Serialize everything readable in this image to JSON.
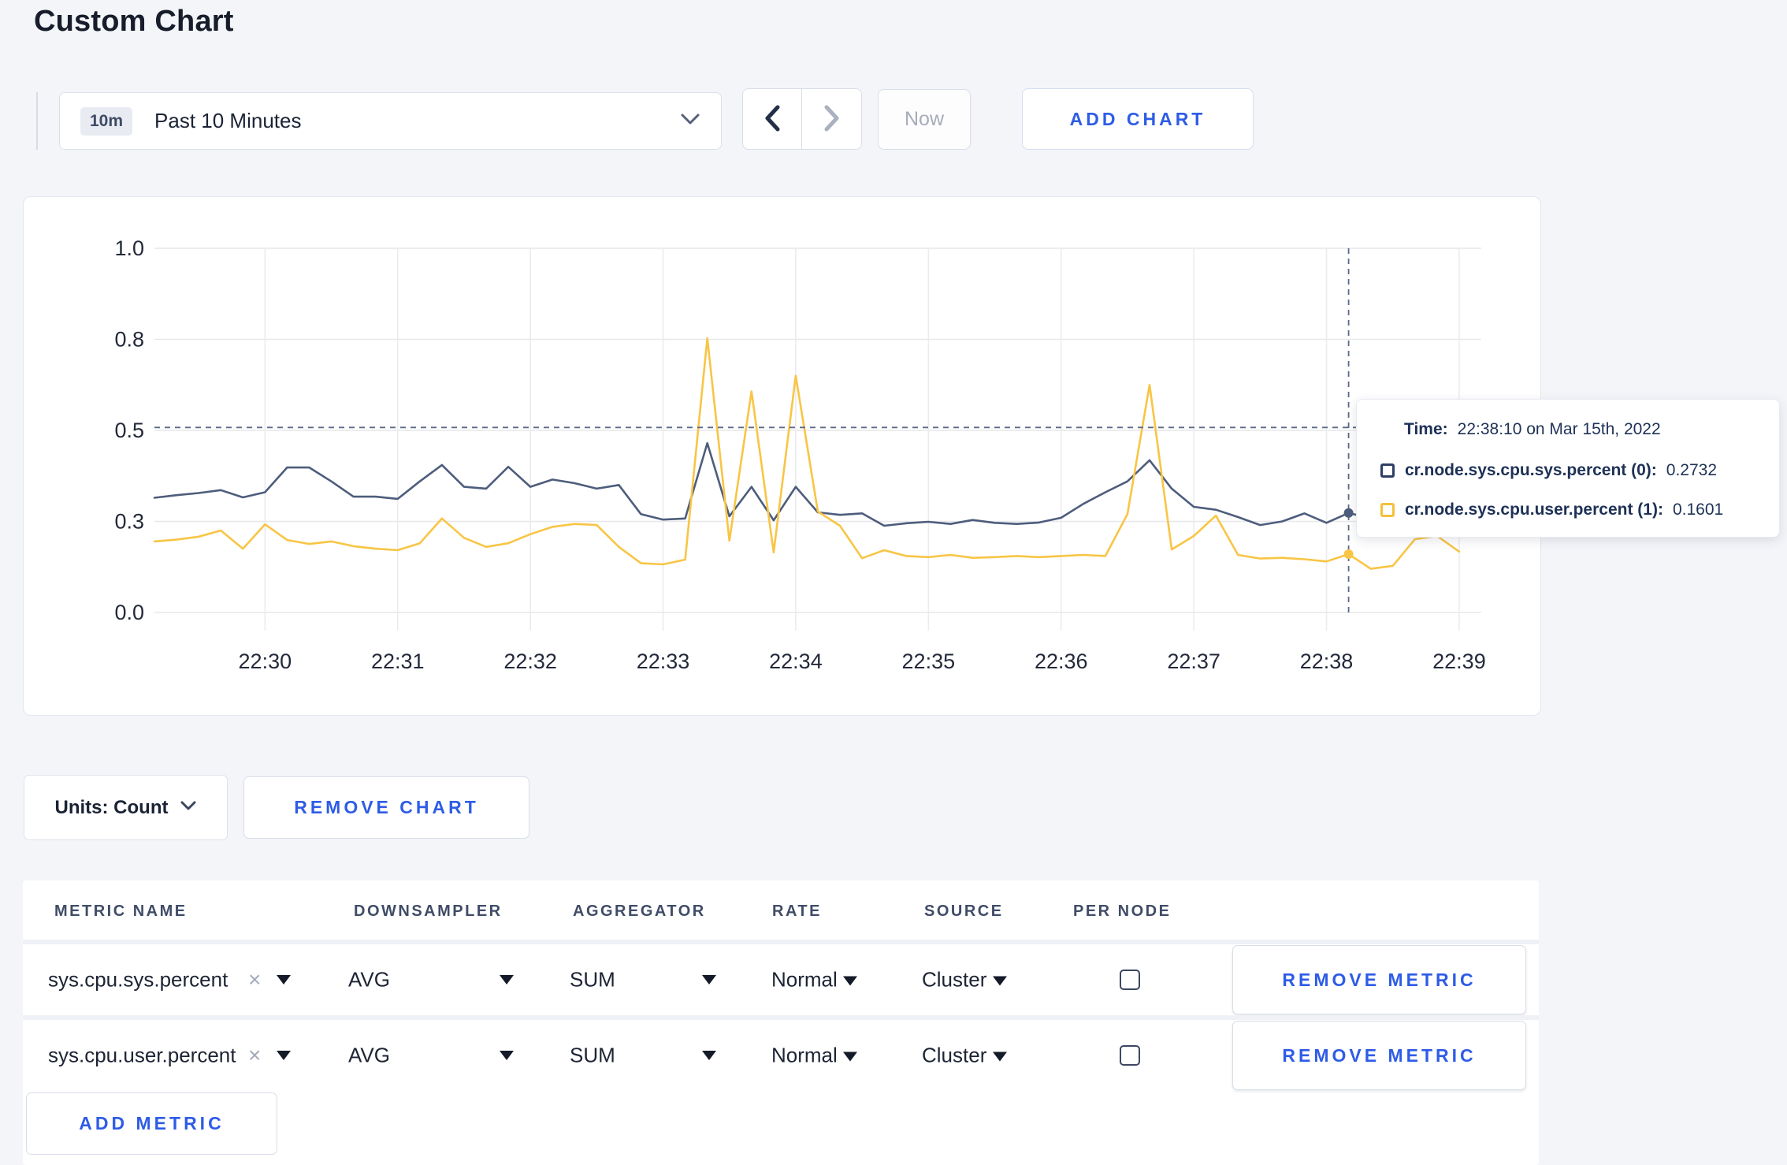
{
  "page": {
    "title": "Custom Chart"
  },
  "toolbar": {
    "range_badge": "10m",
    "range_label": "Past 10 Minutes",
    "now_label": "Now",
    "add_chart_label": "ADD CHART"
  },
  "chart_data": {
    "type": "line",
    "x_start": "22:29:10",
    "x_step_seconds": 10,
    "x_ticks": [
      "22:30",
      "22:31",
      "22:32",
      "22:33",
      "22:34",
      "22:35",
      "22:36",
      "22:37",
      "22:38",
      "22:39"
    ],
    "y_ticks": [
      {
        "label": "0.0",
        "v": 0.0
      },
      {
        "label": "0.3",
        "v": 0.25
      },
      {
        "label": "0.5",
        "v": 0.5
      },
      {
        "label": "0.8",
        "v": 0.75
      },
      {
        "label": "1.0",
        "v": 1.0
      }
    ],
    "ylim": [
      0,
      1
    ],
    "grid": true,
    "crosshair": {
      "index": 54,
      "time": "22:38:10",
      "hline_value": 0.508
    },
    "series": [
      {
        "name": "cr.node.sys.cpu.sys.percent",
        "color": "#4d5d7c",
        "values": [
          0.315,
          0.322,
          0.328,
          0.336,
          0.316,
          0.33,
          0.398,
          0.398,
          0.36,
          0.318,
          0.318,
          0.312,
          0.36,
          0.405,
          0.345,
          0.34,
          0.4,
          0.345,
          0.365,
          0.355,
          0.34,
          0.35,
          0.27,
          0.255,
          0.258,
          0.465,
          0.264,
          0.345,
          0.253,
          0.345,
          0.275,
          0.268,
          0.272,
          0.238,
          0.245,
          0.249,
          0.243,
          0.254,
          0.246,
          0.243,
          0.247,
          0.26,
          0.298,
          0.33,
          0.36,
          0.418,
          0.34,
          0.29,
          0.282,
          0.262,
          0.24,
          0.25,
          0.272,
          0.246,
          0.2732,
          0.258,
          0.262,
          0.258,
          0.262,
          0.268
        ]
      },
      {
        "name": "cr.node.sys.cpu.user.percent",
        "color": "#f8c545",
        "values": [
          0.195,
          0.2,
          0.208,
          0.225,
          0.175,
          0.242,
          0.199,
          0.188,
          0.195,
          0.182,
          0.175,
          0.171,
          0.19,
          0.258,
          0.205,
          0.18,
          0.19,
          0.215,
          0.235,
          0.243,
          0.24,
          0.18,
          0.135,
          0.132,
          0.145,
          0.753,
          0.197,
          0.607,
          0.165,
          0.65,
          0.277,
          0.238,
          0.149,
          0.171,
          0.155,
          0.152,
          0.158,
          0.15,
          0.152,
          0.155,
          0.152,
          0.155,
          0.158,
          0.155,
          0.27,
          0.625,
          0.173,
          0.21,
          0.266,
          0.158,
          0.148,
          0.15,
          0.146,
          0.14,
          0.1601,
          0.12,
          0.128,
          0.201,
          0.21,
          0.167
        ]
      }
    ]
  },
  "tooltip": {
    "time_label": "Time:",
    "time_value": "22:38:10 on Mar 15th, 2022",
    "series": [
      {
        "label": "cr.node.sys.cpu.sys.percent (0):",
        "value": "0.2732",
        "color": "#2c3f66"
      },
      {
        "label": "cr.node.sys.cpu.user.percent (1):",
        "value": "0.1601",
        "color": "#f5c03c"
      }
    ]
  },
  "chart_controls": {
    "units_label": "Units: Count",
    "remove_chart_label": "REMOVE CHART"
  },
  "metrics_table": {
    "headers": [
      "METRIC NAME",
      "DOWNSAMPLER",
      "AGGREGATOR",
      "RATE",
      "SOURCE",
      "PER NODE"
    ],
    "clear_glyph": "×",
    "rows": [
      {
        "metric": "sys.cpu.sys.percent",
        "downsampler": "AVG",
        "aggregator": "SUM",
        "rate": "Normal",
        "source": "Cluster",
        "per_node_checked": false,
        "remove_label": "REMOVE METRIC"
      },
      {
        "metric": "sys.cpu.user.percent",
        "downsampler": "AVG",
        "aggregator": "SUM",
        "rate": "Normal",
        "source": "Cluster",
        "per_node_checked": false,
        "remove_label": "REMOVE METRIC"
      }
    ],
    "add_metric_label": "ADD METRIC"
  },
  "colors": {
    "accent_blue": "#2e5ce6",
    "series_sys": "#4d5d7c",
    "series_user": "#f8c545",
    "crosshair": "#5a6a87"
  }
}
